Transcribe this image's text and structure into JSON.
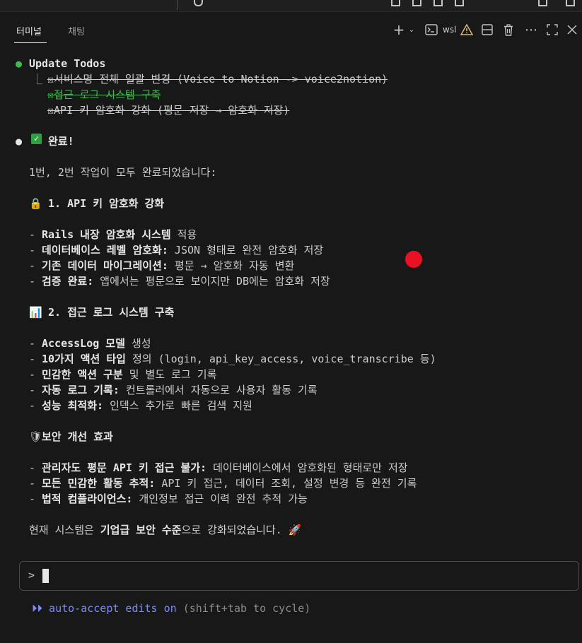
{
  "tabs": [
    {
      "label": "터미널",
      "active": true
    },
    {
      "label": "채팅",
      "active": false
    }
  ],
  "toolbar": {
    "icons": [
      "plus-icon",
      "chevron-down-icon",
      "terminal-icon",
      "warning-icon",
      "split-icon",
      "trash-icon",
      "more-icon",
      "maximize-icon",
      "close-icon"
    ],
    "wsl_label": "wsl"
  },
  "todos": {
    "header": "Update Todos",
    "tree_prefix": "⎿",
    "items": [
      {
        "text": "☒서비스명 전체 일괄 변경 (Voice to Notion -> voice2notion)",
        "state": "done"
      },
      {
        "text": "☒접근 로그 시스템 구축",
        "state": "current"
      },
      {
        "text": "☒API 키 암호화 강화 (평문 저장 → 암호화 저장)",
        "state": "done"
      }
    ]
  },
  "message": {
    "title": "완료!",
    "intro": "1번, 2번 작업이 모두 완료되었습니다:",
    "section1": {
      "emoji": "🔒",
      "title": "1. API 키 암호화 강화",
      "items": [
        {
          "bold": "Rails 내장 암호화 시스템",
          "rest": " 적용"
        },
        {
          "bold": "데이터베이스 레벨 암호화:",
          "rest": " JSON 형태로 완전 암호화 저장"
        },
        {
          "bold": "기존 데이터 마이그레이션:",
          "rest": " 평문 → 암호화 자동 변환"
        },
        {
          "bold": "검증 완료:",
          "rest": " 앱에서는 평문으로 보이지만 DB에는 암호화 저장"
        }
      ]
    },
    "section2": {
      "emoji": "📊",
      "title": "2. 접근 로그 시스템 구축",
      "items": [
        {
          "bold": "AccessLog 모델",
          "rest": " 생성"
        },
        {
          "bold": "10가지 액션 타입",
          "rest": " 정의 (login, api_key_access, voice_transcribe 등)"
        },
        {
          "bold": "민감한 액션 구분",
          "rest": " 및 별도 로그 기록"
        },
        {
          "bold": "자동 로그 기록:",
          "rest": " 컨트롤러에서 자동으로 사용자 활동 기록"
        },
        {
          "bold": "성능 최적화:",
          "rest": " 인덱스 추가로 빠른 검색 지원"
        }
      ]
    },
    "section3": {
      "emoji": "🛡",
      "title": "보안 개선 효과",
      "items": [
        {
          "bold": "관리자도 평문 API 키 접근 불가:",
          "rest": " 데이터베이스에서 암호화된 형태로만 저장"
        },
        {
          "bold": "모든 민감한 활동 추적:",
          "rest": " API 키 접근, 데이터 조회, 설정 변경 등 완전 기록"
        },
        {
          "bold": "법적 컴플라이언스:",
          "rest": " 개인정보 접근 이력 완전 추적 가능"
        }
      ]
    },
    "closing": {
      "before": "현재 시스템은 ",
      "bold": "기업급 보안 수준",
      "after": "으로 강화되었습니다.",
      "emoji": "🚀"
    }
  },
  "input": {
    "prompt": ">"
  },
  "footer": {
    "icon": "⏵⏵",
    "mode": "auto-accept edits on",
    "hint": "(shift+tab to cycle)"
  },
  "colors": {
    "background": "#181818",
    "green": "#3fb950",
    "accent": "#7c8cf8",
    "red_dot": "#e81224",
    "warning": "#d7ba7d"
  }
}
